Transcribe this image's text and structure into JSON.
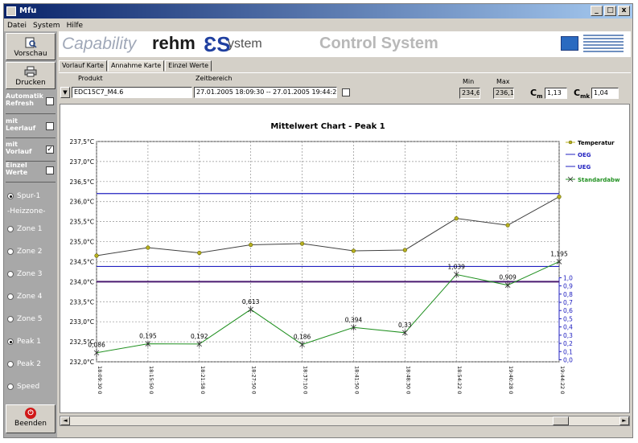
{
  "window": {
    "title": "Mfu",
    "minimize": "_",
    "maximize": "□",
    "close": "x"
  },
  "menu": [
    "Datei",
    "System",
    "Hilfe"
  ],
  "left_panel": {
    "vorschau": "Vorschau",
    "drucken": "Drucken",
    "auto_refresh": [
      "Automatik",
      "Refresh"
    ],
    "leerlauf": [
      "mit",
      "Leerlauf"
    ],
    "vorlauf": [
      "mit",
      "Vorlauf"
    ],
    "einzelwerte": [
      "Einzel",
      "Werte"
    ],
    "spur": "Spur-1",
    "heizzone": "-Heizzone-",
    "zones": [
      "Zone 1",
      "Zone 2",
      "Zone 3",
      "Zone 4",
      "Zone 5",
      "Peak 1",
      "Peak 2",
      "Speed"
    ],
    "beenden": "Beenden"
  },
  "header": {
    "capability": "Capability",
    "rehm": "rehm",
    "system": "ystem",
    "control": "Control System"
  },
  "tabs": [
    "Vorlauf Karte",
    "Annahme Karte",
    "Einzel Werte"
  ],
  "params": {
    "produkt_label": "Produkt",
    "produkt_value": "EDC15C7_M4.6",
    "zeitbereich_label": "Zeitbereich",
    "zeitbereich_value": "27.01.2005 18:09:30 -- 27.01.2005 19:44:22",
    "min_label": "Min",
    "min_value": "234,6",
    "max_label": "Max",
    "max_value": "236,1",
    "cm_label": "C",
    "cm_sub": "m",
    "cm_value": "1,13",
    "cmk_label": "C",
    "cmk_sub": "mk",
    "cmk_value": "1,04"
  },
  "chart_data": {
    "type": "line",
    "title": "Mittelwert Chart - Peak 1",
    "x": [
      "18:09:30 0",
      "18:15:50 0",
      "18:21:58 0",
      "18:27:50 0",
      "18:37:10 0",
      "18:41:50 0",
      "18:48:30 0",
      "18:54:22 0",
      "19:40:28 0",
      "19:44:22 0"
    ],
    "y_left_ticks": [
      "237,5°C",
      "237,0°C",
      "236,5°C",
      "236,0°C",
      "235,5°C",
      "235,0°C",
      "234,5°C",
      "234,0°C",
      "233,5°C",
      "233,0°C",
      "232,5°C",
      "232,0°C"
    ],
    "y_left_range": [
      232.0,
      237.5
    ],
    "y_right_ticks": [
      "1,0",
      "0,9",
      "0,8",
      "0,7",
      "0,6",
      "0,5",
      "0,4",
      "0,3",
      "0,2",
      "0,1",
      "0,0"
    ],
    "y_right_range": [
      0.0,
      1.0
    ],
    "series": [
      {
        "name": "Temperatur",
        "axis": "left",
        "color": "#b8b020",
        "values": [
          234.65,
          234.85,
          234.72,
          234.92,
          234.95,
          234.77,
          234.79,
          235.58,
          235.41,
          236.12
        ]
      },
      {
        "name": "OEG",
        "axis": "left",
        "color": "#2020c0",
        "values": [
          236.2
        ]
      },
      {
        "name": "UEG",
        "axis": "left",
        "color": "#2020c0",
        "values": [
          234.38
        ]
      },
      {
        "name": "Standardabw",
        "axis": "right",
        "color": "#209020",
        "values": [
          0.086,
          0.195,
          0.192,
          0.613,
          0.186,
          0.394,
          0.33,
          1.039,
          0.909,
          1.195
        ],
        "labels": [
          "0,086",
          "0,195",
          "0,192",
          "0,613",
          "0,186",
          "0,394",
          "0,33",
          "1,039",
          "0,909",
          "1,195"
        ]
      }
    ],
    "extra_line": {
      "color": "#4a1a70",
      "value": 234.0
    },
    "grid": true,
    "legend": "right"
  }
}
